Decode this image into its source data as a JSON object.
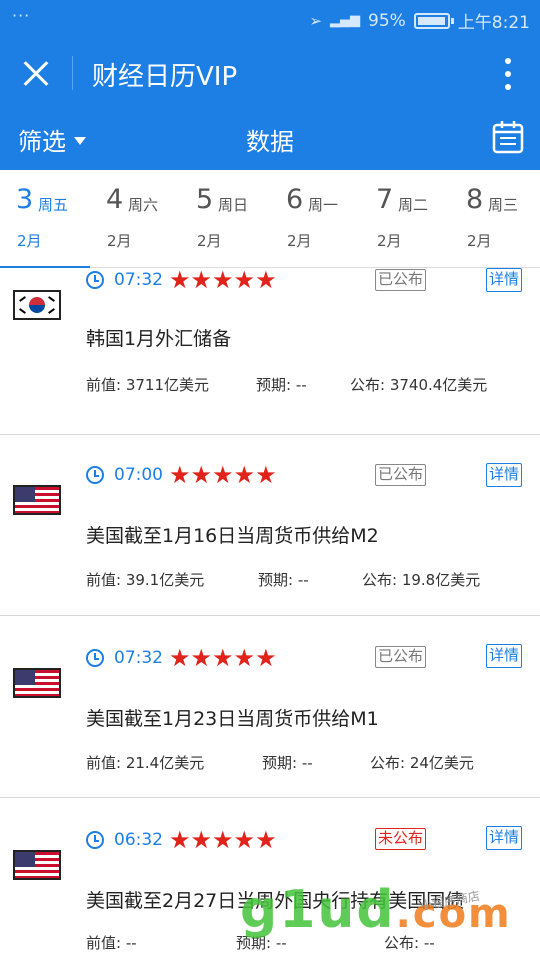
{
  "status_bar": {
    "dots": "···",
    "battery_percent": "95%",
    "battery_level": 0.95,
    "time": "上午8:21"
  },
  "header": {
    "title": "财经日历VIP",
    "filter_label": "筛选",
    "section_title": "数据"
  },
  "date_tabs": [
    {
      "day": "3",
      "weekday": "周五",
      "month": "2月",
      "active": true
    },
    {
      "day": "4",
      "weekday": "周六",
      "month": "2月",
      "active": false
    },
    {
      "day": "5",
      "weekday": "周日",
      "month": "2月",
      "active": false
    },
    {
      "day": "6",
      "weekday": "周一",
      "month": "2月",
      "active": false
    },
    {
      "day": "7",
      "weekday": "周二",
      "month": "2月",
      "active": false
    },
    {
      "day": "8",
      "weekday": "周三",
      "month": "2月",
      "active": false
    }
  ],
  "events": [
    {
      "flag": "south-korea-flag-icon",
      "time": "07:32",
      "stars": "★★★★★",
      "status": "已公布",
      "published": true,
      "detail_label": "详情",
      "title": "韩国1月外汇储备",
      "previous": "前值: 3711亿美元",
      "forecast": "预期: --",
      "actual": "公布: 3740.4亿美元"
    },
    {
      "flag": "usa-flag-icon",
      "time": "07:00",
      "stars": "★★★★★",
      "status": "已公布",
      "published": true,
      "detail_label": "详情",
      "title": "美国截至1月16日当周货币供给M2",
      "previous": "前值: 39.1亿美元",
      "forecast": "预期: --",
      "actual": "公布: 19.8亿美元"
    },
    {
      "flag": "usa-flag-icon",
      "time": "07:32",
      "stars": "★★★★★",
      "status": "已公布",
      "published": true,
      "detail_label": "详情",
      "title": "美国截至1月23日当周货币供给M1",
      "previous": "前值: 21.4亿美元",
      "forecast": "预期: --",
      "actual": "公布: 24亿美元"
    },
    {
      "flag": "usa-flag-icon",
      "time": "06:32",
      "stars": "★★★★★",
      "status": "未公布",
      "published": false,
      "detail_label": "详情",
      "title": "美国截至2月27日当周外国央行持有美国国债",
      "previous": "前值: --",
      "forecast": "预期: --",
      "actual": "公布: --"
    }
  ],
  "watermark": {
    "main": "g1ud",
    "suffix": ".com",
    "sub": "小程序商店"
  },
  "colors": {
    "brand": "#1d7fe3",
    "star": "#e0241b",
    "unpublished": "#e0241b"
  }
}
